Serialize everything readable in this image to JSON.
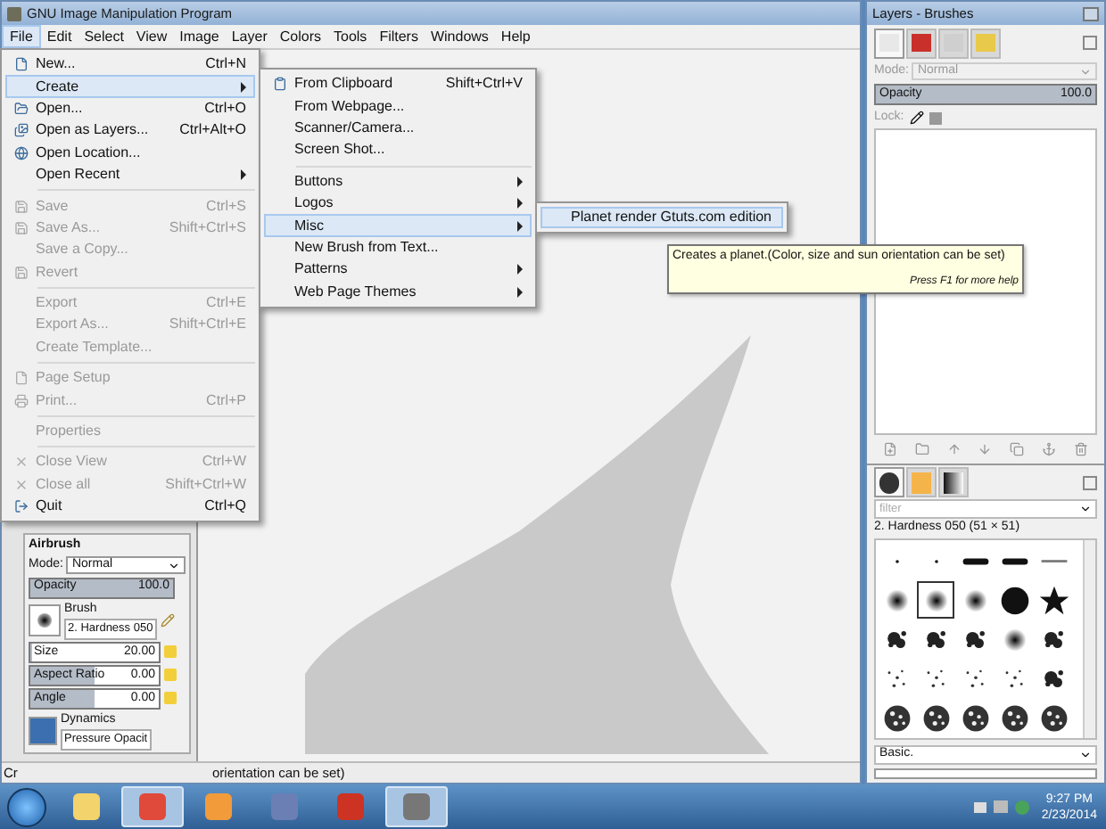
{
  "main_window": {
    "title": "GNU Image Manipulation Program",
    "menubar": [
      {
        "label": "File",
        "selected": true
      },
      {
        "label": "Edit",
        "selected": false
      },
      {
        "label": "Select",
        "selected": false
      },
      {
        "label": "View",
        "selected": false
      },
      {
        "label": "Image",
        "selected": false
      },
      {
        "label": "Layer",
        "selected": false
      },
      {
        "label": "Colors",
        "selected": false
      },
      {
        "label": "Tools",
        "selected": false
      },
      {
        "label": "Filters",
        "selected": false
      },
      {
        "label": "Windows",
        "selected": false
      },
      {
        "label": "Help",
        "selected": false
      }
    ],
    "file_menu": [
      {
        "kind": "item",
        "label": "New...",
        "shortcut": "Ctrl+N",
        "disabled": false,
        "selected": false,
        "submenu": false
      },
      {
        "kind": "item",
        "label": "Create",
        "disabled": false,
        "selected": true,
        "submenu": true
      },
      {
        "kind": "item",
        "label": "Open...",
        "shortcut": "Ctrl+O",
        "disabled": false,
        "selected": false,
        "submenu": false
      },
      {
        "kind": "item",
        "label": "Open as Layers...",
        "shortcut": "Ctrl+Alt+O",
        "disabled": false,
        "selected": false,
        "submenu": false
      },
      {
        "kind": "item",
        "label": "Open Location...",
        "disabled": false,
        "selected": false,
        "submenu": false
      },
      {
        "kind": "item",
        "label": "Open Recent",
        "disabled": false,
        "selected": false,
        "submenu": true
      },
      {
        "kind": "separator"
      },
      {
        "kind": "item",
        "label": "Save",
        "shortcut": "Ctrl+S",
        "disabled": true,
        "selected": false,
        "submenu": false
      },
      {
        "kind": "item",
        "label": "Save As...",
        "shortcut": "Shift+Ctrl+S",
        "disabled": true,
        "selected": false,
        "submenu": false
      },
      {
        "kind": "item",
        "label": "Save a Copy...",
        "disabled": true,
        "selected": false,
        "submenu": false
      },
      {
        "kind": "item",
        "label": "Revert",
        "disabled": true,
        "selected": false,
        "submenu": false
      },
      {
        "kind": "separator"
      },
      {
        "kind": "item",
        "label": "Export",
        "shortcut": "Ctrl+E",
        "disabled": true,
        "selected": false,
        "submenu": false
      },
      {
        "kind": "item",
        "label": "Export As...",
        "shortcut": "Shift+Ctrl+E",
        "disabled": true,
        "selected": false,
        "submenu": false
      },
      {
        "kind": "item",
        "label": "Create Template...",
        "disabled": true,
        "selected": false,
        "submenu": false
      },
      {
        "kind": "separator"
      },
      {
        "kind": "item",
        "label": "Page Setup",
        "disabled": true,
        "selected": false,
        "submenu": false
      },
      {
        "kind": "item",
        "label": "Print...",
        "shortcut": "Ctrl+P",
        "disabled": true,
        "selected": false,
        "submenu": false
      },
      {
        "kind": "separator"
      },
      {
        "kind": "item",
        "label": "Properties",
        "disabled": true,
        "selected": false,
        "submenu": false
      },
      {
        "kind": "separator"
      },
      {
        "kind": "item",
        "label": "Close View",
        "shortcut": "Ctrl+W",
        "disabled": true,
        "selected": false,
        "submenu": false
      },
      {
        "kind": "item",
        "label": "Close all",
        "shortcut": "Shift+Ctrl+W",
        "disabled": true,
        "selected": false,
        "submenu": false
      },
      {
        "kind": "item",
        "label": "Quit",
        "shortcut": "Ctrl+Q",
        "disabled": false,
        "selected": false,
        "submenu": false
      }
    ],
    "create_menu": [
      {
        "kind": "item",
        "label": "From Clipboard",
        "shortcut": "Shift+Ctrl+V",
        "disabled": false,
        "selected": false,
        "submenu": false
      },
      {
        "kind": "item",
        "label": "From Webpage...",
        "disabled": false,
        "selected": false,
        "submenu": false
      },
      {
        "kind": "item",
        "label": "Scanner/Camera...",
        "disabled": false,
        "selected": false,
        "submenu": false
      },
      {
        "kind": "item",
        "label": "Screen Shot...",
        "disabled": false,
        "selected": false,
        "submenu": false
      },
      {
        "kind": "separator"
      },
      {
        "kind": "item",
        "label": "Buttons",
        "disabled": false,
        "selected": false,
        "submenu": true
      },
      {
        "kind": "item",
        "label": "Logos",
        "disabled": false,
        "selected": false,
        "submenu": true
      },
      {
        "kind": "item",
        "label": "Misc",
        "disabled": false,
        "selected": true,
        "submenu": true
      },
      {
        "kind": "item",
        "label": "New Brush from Text...",
        "disabled": false,
        "selected": false,
        "submenu": false
      },
      {
        "kind": "item",
        "label": "Patterns",
        "disabled": false,
        "selected": false,
        "submenu": true
      },
      {
        "kind": "item",
        "label": "Web Page Themes",
        "disabled": false,
        "selected": false,
        "submenu": true
      }
    ],
    "misc_menu": [
      {
        "kind": "item",
        "label": "Planet render Gtuts.com edition",
        "disabled": false,
        "selected": true,
        "submenu": false
      }
    ],
    "tooltip": {
      "text": "Creates a planet.(Color, size and sun orientation can be set)",
      "help": "Press F1 for more help"
    },
    "tool_options": {
      "title": "Airbrush",
      "mode_label": "Mode:",
      "mode": "Normal",
      "opacity": {
        "label": "Opacity",
        "value": "100.0",
        "level": 1
      },
      "brush": {
        "label": "Brush",
        "value": "2. Hardness 050"
      },
      "sliders": [
        {
          "label": "Size",
          "value": "20.00",
          "level": 0.02
        },
        {
          "label": "Aspect Ratio",
          "value": "0.00",
          "level": 0.5
        },
        {
          "label": "Angle",
          "value": "0.00",
          "level": 0.5
        }
      ],
      "dynamics": {
        "label": "Dynamics",
        "value": "Pressure Opacit"
      }
    },
    "status_bar": {
      "left": "Cr",
      "right": "orientation can be set)"
    }
  },
  "dock": {
    "title": "Layers - Brushes",
    "top_tabs": [
      {
        "selected": true
      },
      {
        "selected": false
      },
      {
        "selected": false
      },
      {
        "selected": false
      }
    ],
    "mode_label": "Mode:",
    "mode": "Normal",
    "opacity": {
      "label": "Opacity",
      "value": "100.0",
      "level": 1
    },
    "lock_label": "Lock:",
    "bottom_tabs": [
      {
        "selected": true
      },
      {
        "selected": false
      },
      {
        "selected": false
      }
    ],
    "filter_placeholder": "filter",
    "brush_name": "2. Hardness 050 (51 × 51)",
    "brushes": [
      {
        "kind": "dot",
        "selected": false
      },
      {
        "kind": "dot",
        "selected": false
      },
      {
        "kind": "bar",
        "selected": false
      },
      {
        "kind": "bar",
        "selected": false
      },
      {
        "kind": "line",
        "selected": false
      },
      {
        "kind": "soft",
        "selected": false
      },
      {
        "kind": "soft",
        "selected": true
      },
      {
        "kind": "soft",
        "selected": false
      },
      {
        "kind": "hard",
        "selected": false
      },
      {
        "kind": "star",
        "selected": false
      },
      {
        "kind": "splatter",
        "selected": false
      },
      {
        "kind": "splatter",
        "selected": false
      },
      {
        "kind": "splatter",
        "selected": false
      },
      {
        "kind": "soft",
        "selected": false
      },
      {
        "kind": "splatter",
        "selected": false
      },
      {
        "kind": "sparse",
        "selected": false
      },
      {
        "kind": "sparse",
        "selected": false
      },
      {
        "kind": "sparse",
        "selected": false
      },
      {
        "kind": "sparse",
        "selected": false
      },
      {
        "kind": "splatter",
        "selected": false
      },
      {
        "kind": "texture",
        "selected": false
      },
      {
        "kind": "texture",
        "selected": false
      },
      {
        "kind": "texture",
        "selected": false
      },
      {
        "kind": "texture",
        "selected": false
      },
      {
        "kind": "texture",
        "selected": false
      }
    ],
    "preset": "Basic."
  },
  "taskbar": {
    "apps": [
      {
        "selected": false
      },
      {
        "selected": true
      },
      {
        "selected": false
      },
      {
        "selected": false
      },
      {
        "selected": false
      },
      {
        "selected": true
      }
    ],
    "time": "9:27 PM",
    "date": "2/23/2014"
  }
}
